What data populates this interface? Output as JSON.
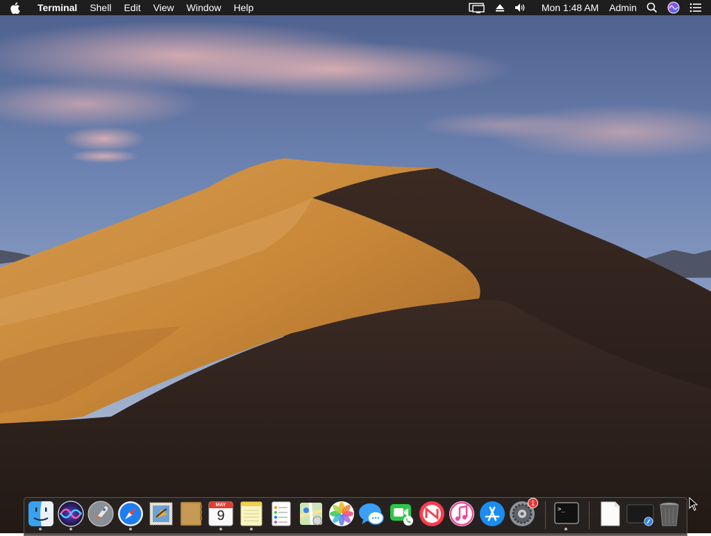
{
  "menubar": {
    "app_name": "Terminal",
    "menus": [
      "Shell",
      "Edit",
      "View",
      "Window",
      "Help"
    ],
    "clock": "Mon 1:48 AM",
    "user": "Admin",
    "status_icons": [
      "display-mirroring-icon",
      "eject-icon",
      "volume-icon",
      "spotlight-icon",
      "siri-icon",
      "notification-center-icon"
    ]
  },
  "dock": {
    "apps": [
      {
        "name": "Finder",
        "icon": "finder-icon",
        "running": true
      },
      {
        "name": "Siri",
        "icon": "siri-icon",
        "running": true
      },
      {
        "name": "Launchpad",
        "icon": "launchpad-icon",
        "running": false
      },
      {
        "name": "Safari",
        "icon": "safari-icon",
        "running": true
      },
      {
        "name": "Mail",
        "icon": "mail-icon",
        "running": false
      },
      {
        "name": "Contacts",
        "icon": "contacts-icon",
        "running": false
      },
      {
        "name": "Calendar",
        "icon": "calendar-icon",
        "running": true,
        "month": "MAY",
        "day": "9"
      },
      {
        "name": "Notes",
        "icon": "notes-icon",
        "running": true
      },
      {
        "name": "Reminders",
        "icon": "reminders-icon",
        "running": false
      },
      {
        "name": "Maps",
        "icon": "maps-icon",
        "running": false
      },
      {
        "name": "Photos",
        "icon": "photos-icon",
        "running": false
      },
      {
        "name": "Messages",
        "icon": "messages-icon",
        "running": false
      },
      {
        "name": "FaceTime",
        "icon": "facetime-icon",
        "running": false
      },
      {
        "name": "News",
        "icon": "news-icon",
        "running": false
      },
      {
        "name": "iTunes",
        "icon": "itunes-icon",
        "running": false
      },
      {
        "name": "App Store",
        "icon": "app-store-icon",
        "running": false
      },
      {
        "name": "System Preferences",
        "icon": "system-preferences-icon",
        "running": false,
        "badge": "1"
      },
      {
        "name": "Terminal",
        "icon": "terminal-icon",
        "running": true
      },
      {
        "name": "Document",
        "icon": "document-icon",
        "running": false
      },
      {
        "name": "Screen Sharing",
        "icon": "screen-sharing-icon",
        "running": false
      },
      {
        "name": "Trash",
        "icon": "trash-icon",
        "running": false
      }
    ],
    "terminal_prompt": ">_"
  }
}
